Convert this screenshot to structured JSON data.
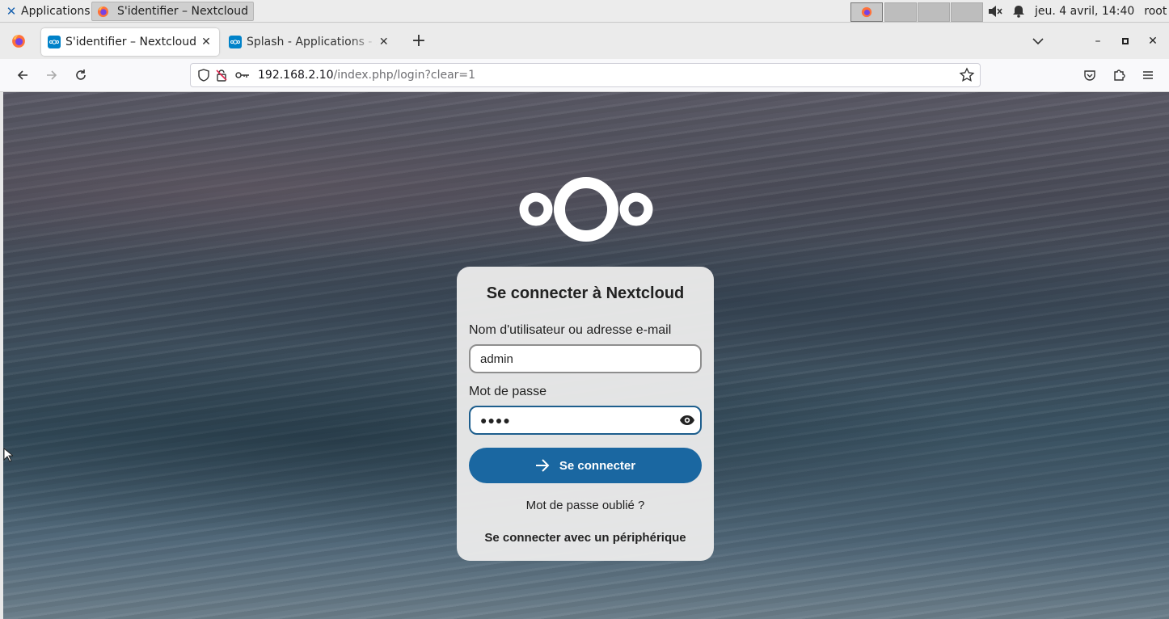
{
  "taskbar": {
    "apps_label": "Applications",
    "apps_menu_glyph": "☰",
    "active_window_title": "S'identifier – Nextcloud ...",
    "clock": "jeu.  4 avril, 14:40",
    "user": "root",
    "icons": [
      "xfce-logo-icon",
      "firefox-icon",
      "volume-muted-icon",
      "bell-icon"
    ]
  },
  "browser": {
    "tabs": [
      {
        "title": "S'identifier – Nextcloud",
        "active": true,
        "favicon": "nextcloud-favicon"
      },
      {
        "title": "Splash - Applications - Apps",
        "active": false,
        "favicon": "nextcloud-favicon"
      }
    ],
    "new_tab_glyph": "+",
    "url_host": "192.168.2.10",
    "url_path": "/index.php/login?clear=1",
    "window_controls": {
      "minimize": "–",
      "maximize": "▫",
      "close": "✕"
    }
  },
  "login": {
    "title": "Se connecter à Nextcloud",
    "username_label": "Nom d'utilisateur ou adresse e-mail",
    "username_value": "admin",
    "password_label": "Mot de passe",
    "password_masked": "●●●●",
    "submit_label": "Se connecter",
    "forgot_link": "Mot de passe oublié ?",
    "device_link": "Se connecter avec un périphérique"
  },
  "colors": {
    "primary": "#1a67a1",
    "nextcloud_blue": "#0082c9",
    "focused_border": "#1d5e8d"
  }
}
